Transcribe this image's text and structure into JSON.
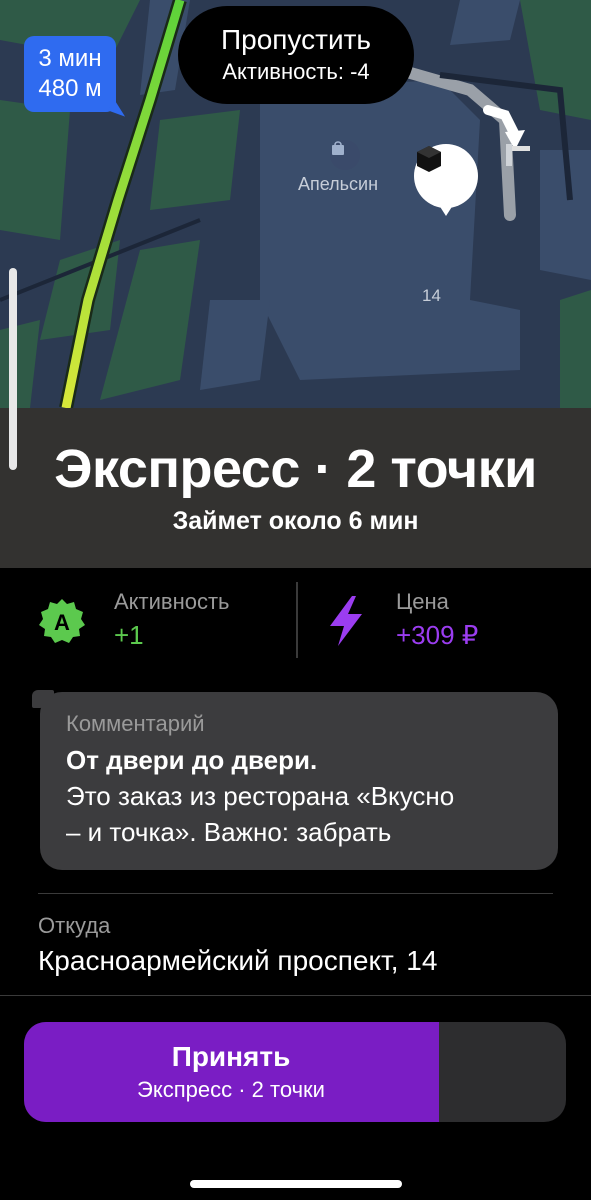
{
  "map": {
    "eta_time": "3 мин",
    "eta_distance": "480 м",
    "poi_label": "Апельсин",
    "building_number": "14"
  },
  "skip_button": {
    "label": "Пропустить",
    "activity": "Активность: -4"
  },
  "order": {
    "title": "Экспресс · 2 точки",
    "subtitle": "Займет около 6 мин"
  },
  "stats": {
    "activity_badge": "A",
    "activity_label": "Активность",
    "activity_value": "+1",
    "price_label": "Цена",
    "price_value": "+309 ₽"
  },
  "comment": {
    "label": "Комментарий",
    "bold": "От двери до двери.",
    "line1": "Это заказ из ресторана «Вкусно",
    "line2": "– и точка». Важно: забрать"
  },
  "from": {
    "label": "Откуда",
    "address": "Красноармейский проспект, 14"
  },
  "accept_button": {
    "label": "Принять",
    "sublabel": "Экспресс · 2 точки",
    "progress_fraction": 0.765
  },
  "colors": {
    "accent_purple": "#7a1dc4",
    "activity_green": "#5cc94e",
    "price_purple": "#9b3df0",
    "eta_blue": "#2f6bf0"
  }
}
